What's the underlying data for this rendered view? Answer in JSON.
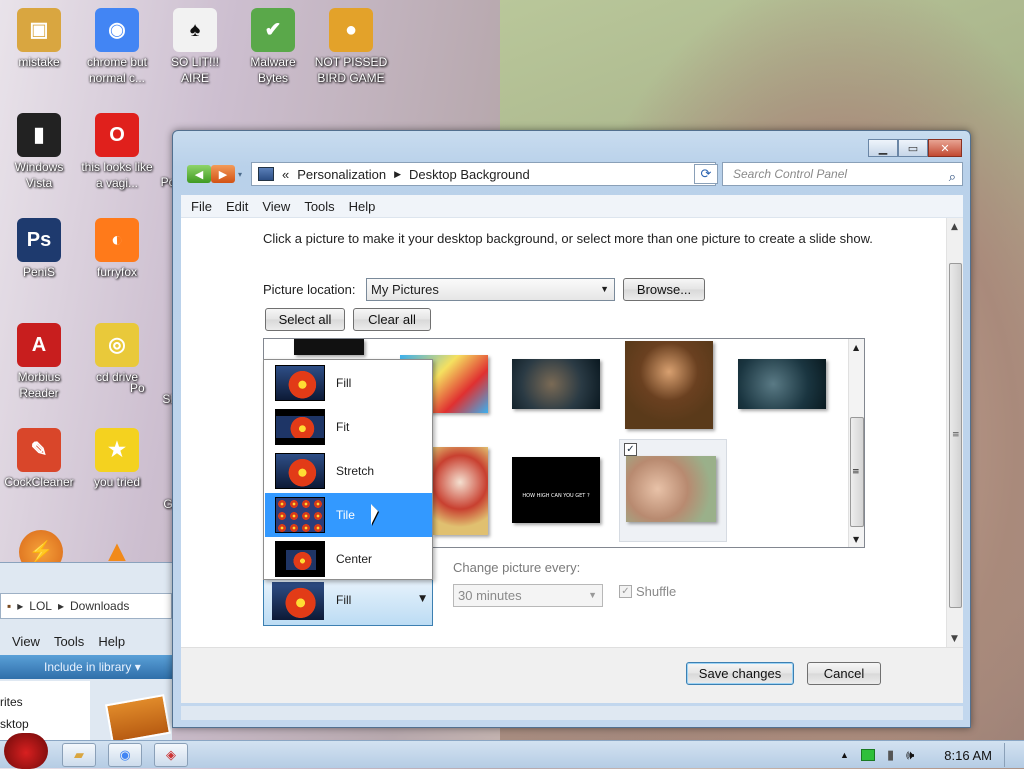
{
  "desktop": {
    "icons": [
      {
        "label": "mistake",
        "icon": "folder-icon",
        "color": "#d9a640"
      },
      {
        "label": "chrome but normal c...",
        "icon": "chrome-icon",
        "color": "#4285f4"
      },
      {
        "label": "SO LIT!!! AIRE",
        "icon": "playing-card-icon",
        "color": "#f2f2f2"
      },
      {
        "label": "Malware Bytes",
        "icon": "shield-icon",
        "color": "#5aa84a"
      },
      {
        "label": "NOT PISSED BIRD GAME",
        "icon": "green-pig-icon",
        "color": "#e3a22a"
      },
      {
        "label": "Windows Vista",
        "icon": "black-cylinder-icon",
        "color": "#222222"
      },
      {
        "label": "this looks like a vagi...",
        "icon": "opera-icon",
        "color": "#e0201c"
      },
      {
        "label": "PeniS",
        "icon": "photoshop-icon",
        "color": "#1e3a6e"
      },
      {
        "label": "furryfox",
        "icon": "firefox-icon",
        "color": "#ff7a1a"
      },
      {
        "label": "Morbius Reader",
        "icon": "acrobat-icon",
        "color": "#c81e1e"
      },
      {
        "label": "cd drive",
        "icon": "cd-icon",
        "color": "#e9c93a"
      },
      {
        "label": "CockCleaner",
        "icon": "broom-icon",
        "color": "#d9462a"
      },
      {
        "label": "you tried",
        "icon": "star-icon",
        "color": "#f4d21f"
      }
    ],
    "partial_labels": [
      "Po",
      "SI",
      "G"
    ]
  },
  "explorer": {
    "path": [
      "LOL",
      "Downloads"
    ],
    "menu": [
      "View",
      "Tools",
      "Help"
    ],
    "command": "Include in library",
    "sidebar": [
      "rites",
      "sktop"
    ]
  },
  "window": {
    "address": {
      "sep": "«",
      "crumbs": [
        "Personalization",
        "Desktop Background"
      ]
    },
    "search_placeholder": "Search Control Panel",
    "menu": [
      "File",
      "Edit",
      "View",
      "Tools",
      "Help"
    ],
    "description": "Click a picture to make it your desktop background, or select more than one picture to create a slide show.",
    "picture_location_label": "Picture location:",
    "picture_location_value": "My Pictures",
    "browse_button": "Browse...",
    "select_all_button": "Select all",
    "clear_all_button": "Clear all",
    "thumbnail_caption": "HOW HIGH CAN YOU GET ?",
    "position_options": [
      {
        "label": "Fill",
        "selected": false
      },
      {
        "label": "Fit",
        "selected": false
      },
      {
        "label": "Stretch",
        "selected": false
      },
      {
        "label": "Tile",
        "selected": true
      },
      {
        "label": "Center",
        "selected": false
      }
    ],
    "position_value": "Fill",
    "change_picture_label": "Change picture every:",
    "change_picture_value": "30 minutes",
    "shuffle_label": "Shuffle",
    "save_button": "Save changes",
    "cancel_button": "Cancel"
  },
  "taskbar": {
    "time": "8:16 AM"
  },
  "colors": {
    "selection": "#3399ff",
    "titlebar": "#c2d7ee",
    "close": "#c24a32"
  }
}
